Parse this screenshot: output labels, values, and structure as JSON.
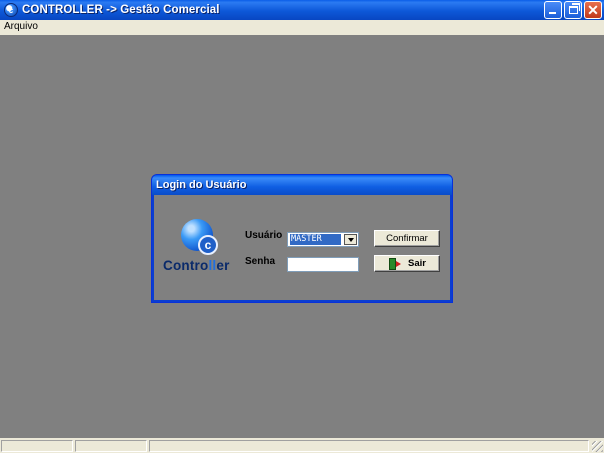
{
  "window": {
    "title": "CONTROLLER -> Gestão Comercial",
    "icon": "controller-app-icon",
    "buttons": [
      "minimize",
      "restore",
      "close"
    ]
  },
  "menu": {
    "items": [
      "Arquivo"
    ]
  },
  "login_dialog": {
    "title": "Login do Usuário",
    "logo": {
      "letter": "c",
      "text_start": "Contro",
      "text_highlight": "ll",
      "text_end": "er"
    },
    "user_label": "Usuário",
    "user_value": "MASTER",
    "password_label": "Senha",
    "password_value": "",
    "confirm_button": "Confirmar",
    "exit_button": "Sair"
  },
  "statusbar": {
    "panels": [
      "",
      "",
      ""
    ]
  },
  "colors": {
    "desktop": "#808080",
    "titlebar": "#0a4cc8",
    "selection": "#316ac5"
  }
}
